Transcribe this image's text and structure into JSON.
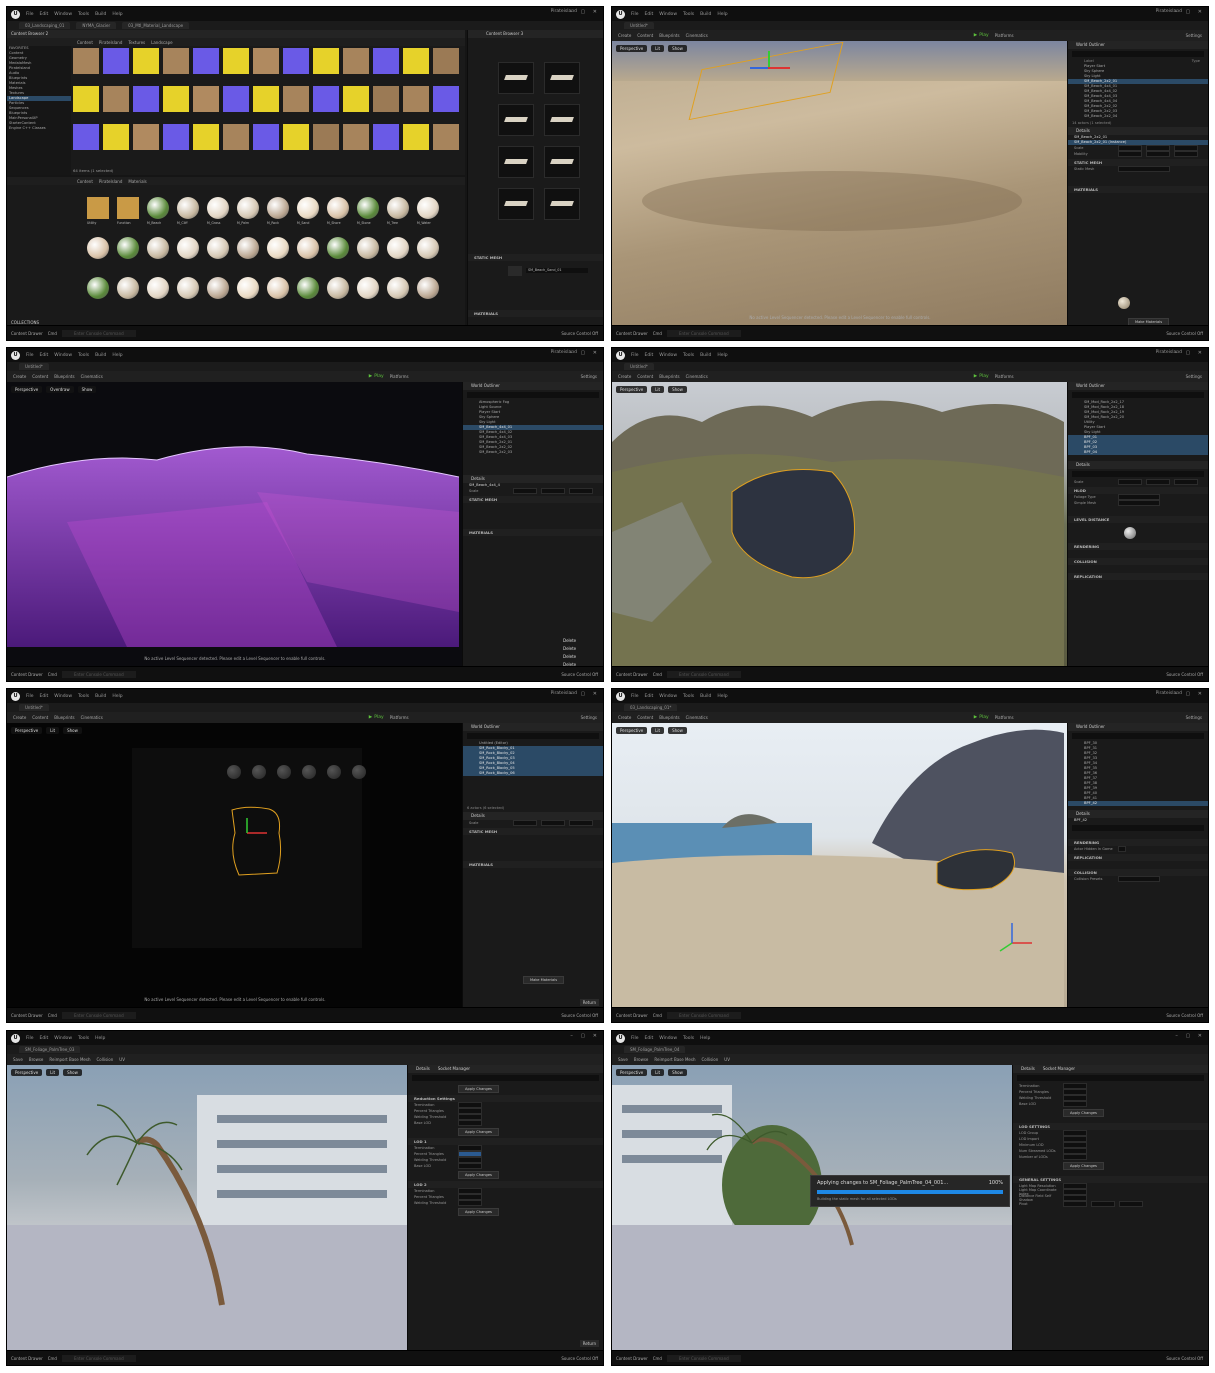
{
  "menu": [
    "File",
    "Edit",
    "Window",
    "Tools",
    "Build",
    "Help"
  ],
  "project_name": "Pirateisland",
  "toolbar": {
    "create": "Create",
    "content": "Content",
    "blueprints": "Blueprints",
    "cinematics": "Cinematics",
    "play": "Play",
    "platforms": "Platforms",
    "settings": "Settings"
  },
  "status": {
    "content_drawer": "Content Drawer",
    "cmd": "Cmd",
    "cmd_placeholder": "Enter Console Command",
    "source_control": "Source Control Off"
  },
  "viewport": {
    "perspective": "Perspective",
    "lit": "Lit",
    "show": "Show",
    "overdraw": "Overdraw",
    "no_sequencer": "No active Level Sequencer detected. Please edit a Level Sequencer to enable full controls."
  },
  "panels": {
    "p1": {
      "tabs": [
        "03_Landscaping_01",
        "NYMA_Glacier",
        "03_Mtl_Material_Landscape"
      ],
      "cb_title": "Content Browser 2",
      "breadcrumb": [
        "Content",
        "PirateIsland",
        "Textures",
        "Landscape"
      ],
      "tree": [
        "FAVORITES",
        "Content",
        "Geometry",
        "MedalaMesh",
        "PirateIsland",
        "Audio",
        "Blueprints",
        "Materials",
        "Meshes",
        "Textures",
        "Landscape",
        "Particles",
        "Sequences",
        "Blueprints",
        "MainPersonalXP",
        "StarterContent",
        "Engine C++ Classes"
      ],
      "items_count": "64 items (1 selected)",
      "cb2_breadcrumb": [
        "Content",
        "PirateIsland",
        "Materials"
      ],
      "sphere_labels": [
        "Utility",
        "Function",
        "M_Beach",
        "M_Cliff",
        "M_Grass",
        "M_Palm",
        "M_Rock",
        "M_Sand",
        "M_Shore",
        "M_Stone",
        "M_Tree",
        "M_Water"
      ],
      "collections": "COLLECTIONS",
      "cb3_title": "Content Browser 3",
      "static_mesh": "STATIC MESH",
      "materials": "MATERIALS",
      "mesh_name": "SM_Beach_Sand_01"
    },
    "p2": {
      "tab": "Untitled*",
      "outliner": "World Outliner",
      "col_label": "Label",
      "col_type": "Type",
      "rows": [
        "Player Start",
        "Sky Sphere",
        "Sky Light",
        "SM_Beach_2x2_01",
        "SM_Beach_4x4_01",
        "SM_Beach_4x4_02",
        "SM_Beach_4x4_03",
        "SM_Beach_4x4_04",
        "SM_Beach_2x2_02",
        "SM_Beach_2x2_03",
        "SM_Beach_2x2_04"
      ],
      "actors": "14 actors (1 selected)",
      "details": "Details",
      "selected": "SM_Beach_2x2_01",
      "component": "SM_Beach_2x2_01 (Instance)",
      "static_mesh": "STATIC MESH",
      "materials": "MATERIALS",
      "browse": "Make Materials"
    },
    "p3": {
      "rows": [
        "Atmospheric Fog",
        "Light Source",
        "Player Start",
        "Sky Sphere",
        "Sky Light",
        "SM_Beach_4x4_01",
        "SM_Beach_4x4_02",
        "SM_Beach_4x4_03",
        "SM_Beach_2x2_01",
        "SM_Beach_2x2_02",
        "SM_Beach_2x2_03"
      ],
      "selected": "SM_Beach_4x4_4",
      "delete": [
        "Delete",
        "Delete",
        "Delete",
        "Delete"
      ]
    },
    "p4": {
      "rows": [
        "SM_Mod_Rock_2x2_17",
        "SM_Mod_Rock_2x2_18",
        "SM_Mod_Rock_2x2_19",
        "SM_Mod_Rock_2x2_20",
        "Utility",
        "Player Start",
        "Sky Light",
        "BPF_01",
        "BPF_02",
        "BPF_03",
        "BPF_04"
      ],
      "sections": [
        "HLOD",
        "LEVEL DISTANCE",
        "RENDERING",
        "COLLISION",
        "REPLICATION"
      ]
    },
    "p5": {
      "rows": [
        "Untitled (Editor)",
        "SM_Rock_Blocky_01",
        "SM_Rock_Blocky_02",
        "SM_Rock_Blocky_03",
        "SM_Rock_Blocky_04",
        "SM_Rock_Blocky_05",
        "SM_Rock_Blocky_06"
      ],
      "actors": "6 actors (6 selected)",
      "return": "Return"
    },
    "p6": {
      "tab": "03_Landscaping_01*",
      "rows": [
        "BPF_30",
        "BPF_31",
        "BPF_32",
        "BPF_33",
        "BPF_34",
        "BPF_35",
        "BPF_36",
        "BPF_37",
        "BPF_38",
        "BPF_39",
        "BPF_40",
        "BPF_41",
        "BPF_42"
      ],
      "selected": "BPF_42"
    },
    "p7": {
      "tab": "SM_Foliage_PalmTree_03",
      "tb": [
        "Save",
        "Browse",
        "Reimport Base Mesh",
        "Collision",
        "UV"
      ],
      "details": "Details",
      "socket": "Socket Manager",
      "sections": [
        "Reduction Settings",
        "LOD 1",
        "LOD 2",
        "LOD 3"
      ],
      "apply": "Apply Changes",
      "return": "Return"
    },
    "p8": {
      "tab": "SM_Foliage_PalmTree_04",
      "progress_text": "Applying changes to SM_Foliage_PalmTree_04_001...",
      "progress_pct": "100%",
      "progress_sub": "Building the static mesh for all selected LODs",
      "sections": [
        "LOD SETTINGS",
        "GENERAL SETTINGS"
      ],
      "apply": "Apply Changes"
    }
  }
}
